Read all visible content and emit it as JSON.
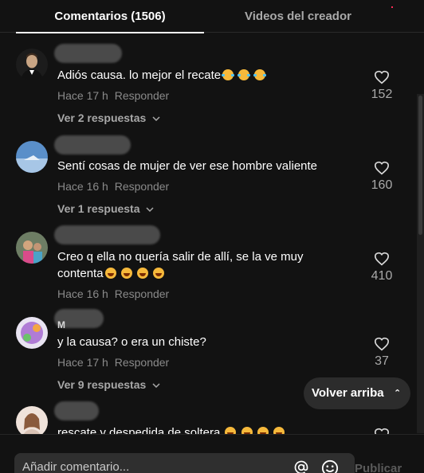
{
  "tabs": [
    {
      "label": "Comentarios (1506)",
      "active": true
    },
    {
      "label": "Videos del creador",
      "active": false
    }
  ],
  "comments": [
    {
      "text": "Adiós causa. lo mejor el recate",
      "emojis": [
        "rolling-laughing",
        "rolling-laughing",
        "rolling-laughing"
      ],
      "time": "Hace 17 h",
      "reply": "Responder",
      "replies": "Ver 2 respuestas",
      "likes": "152"
    },
    {
      "text": "Sentí cosas de mujer de ver ese hombre valiente",
      "emojis": [],
      "time": "Hace 16 h",
      "reply": "Responder",
      "replies": "Ver 1 respuesta",
      "likes": "160"
    },
    {
      "text": "Creo q ella no quería salir de allí, se la ve muy contenta",
      "emojis": [
        "grinning",
        "grinning",
        "grinning",
        "grinning"
      ],
      "time": "Hace 16 h",
      "reply": "Responder",
      "replies": "",
      "likes": "410"
    },
    {
      "text": "y la causa? o era un chiste?",
      "partial_username": "M",
      "emojis": [],
      "time": "Hace 17 h",
      "reply": "Responder",
      "replies": "Ver 9 respuestas",
      "likes": "37"
    },
    {
      "text": "rescate y despedida de soltera",
      "emojis": [
        "grinning",
        "grinning",
        "grinning",
        "grinning"
      ],
      "time": "",
      "reply": "",
      "replies": "",
      "likes": ""
    }
  ],
  "back_to_top": "Volver arriba",
  "composer": {
    "placeholder": "Añadir comentario...",
    "publish": "Publicar"
  },
  "icons": {
    "like": "heart-outline-icon",
    "mention": "at-sign-icon",
    "emoji": "emoji-face-icon",
    "chevron": "chevron-down-icon",
    "up": "double-chevron-up-icon"
  },
  "colors": {
    "background": "#121212",
    "accent": "#fe2c55",
    "muted": "#8a8a8a"
  }
}
